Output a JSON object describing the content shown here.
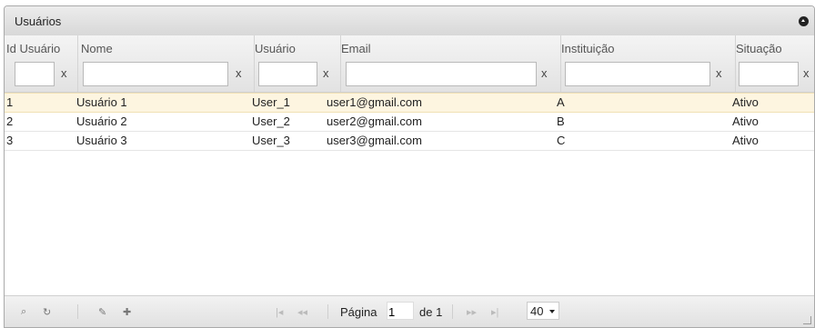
{
  "panel": {
    "title": "Usuários"
  },
  "columns": [
    {
      "key": "id",
      "label": "Id Usuário"
    },
    {
      "key": "nome",
      "label": "Nome"
    },
    {
      "key": "usuario",
      "label": "Usuário"
    },
    {
      "key": "email",
      "label": "Email"
    },
    {
      "key": "instituicao",
      "label": "Instituição"
    },
    {
      "key": "situacao",
      "label": "Situação"
    }
  ],
  "filter_clear_label": "x",
  "rows": [
    {
      "id": "1",
      "nome": "Usuário 1",
      "usuario": "User_1",
      "email": "user1@gmail.com",
      "instituicao": "A",
      "situacao": "Ativo"
    },
    {
      "id": "2",
      "nome": "Usuário 2",
      "usuario": "User_2",
      "email": "user2@gmail.com",
      "instituicao": "B",
      "situacao": "Ativo"
    },
    {
      "id": "3",
      "nome": "Usuário 3",
      "usuario": "User_3",
      "email": "user3@gmail.com",
      "instituicao": "C",
      "situacao": "Ativo"
    }
  ],
  "pager": {
    "page_label": "Página",
    "page_value": "1",
    "of_label": "de 1",
    "rows_per_page": "40"
  },
  "icons": {
    "search": "search-icon",
    "refresh": "refresh-icon",
    "edit": "edit-icon",
    "add": "add-icon",
    "first": "first-page-icon",
    "prev": "prev-page-icon",
    "next": "next-page-icon",
    "last": "last-page-icon"
  }
}
